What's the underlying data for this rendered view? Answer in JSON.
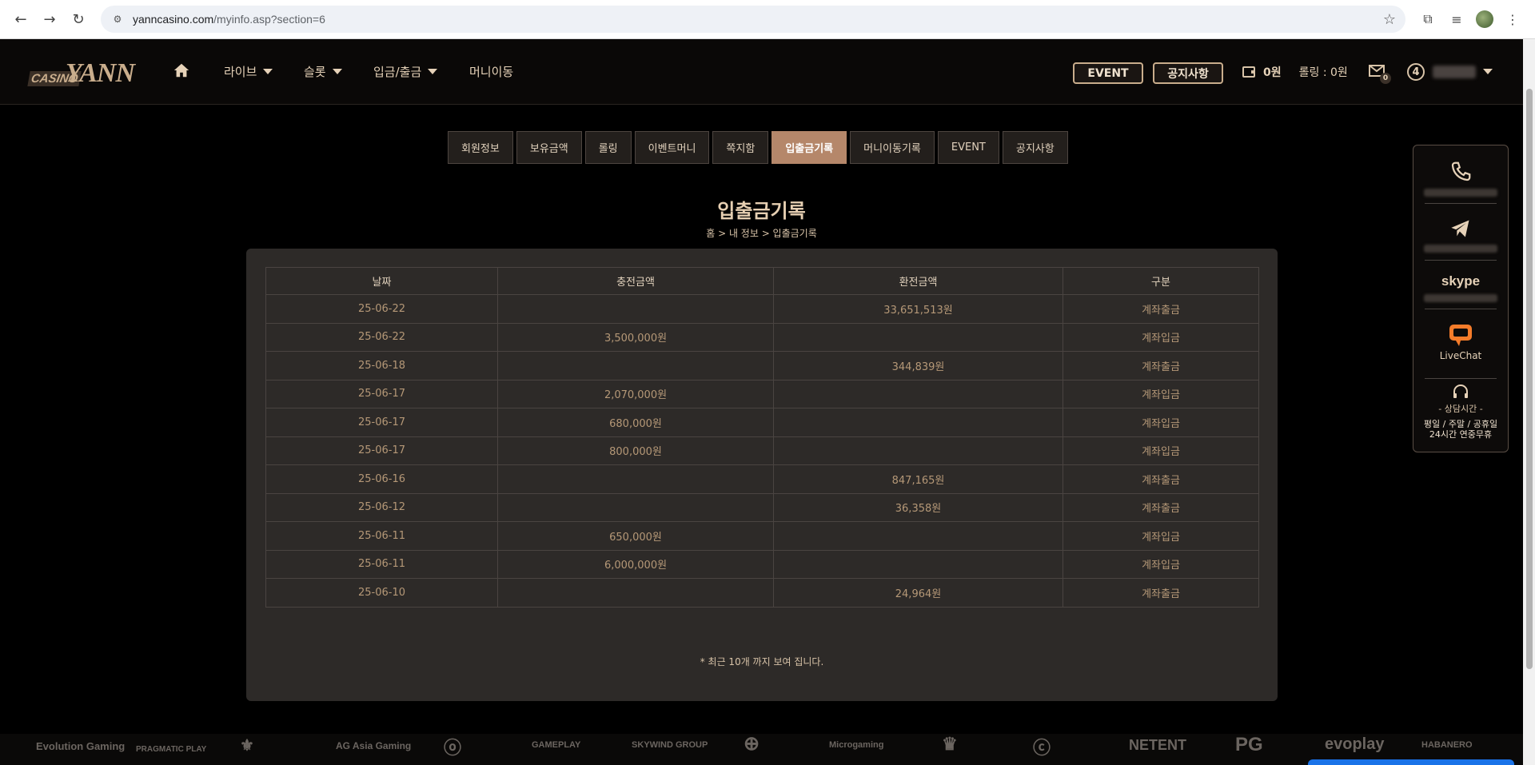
{
  "browser": {
    "url_domain": "yanncasino.com",
    "url_path": "/myinfo.asp?section=6"
  },
  "header": {
    "logo_casino": "CASINO",
    "logo_yann": "YANN",
    "menu": [
      {
        "label": "라이브"
      },
      {
        "label": "슬롯"
      },
      {
        "label": "입금/출금"
      },
      {
        "label": "머니이동"
      }
    ],
    "event_button": "EVENT",
    "notice_button": "공지사항",
    "balance": "0원",
    "rolling": "롤링 : 0원",
    "mail_count": "0",
    "level": "4"
  },
  "tabs": [
    {
      "label": "회원정보",
      "active": false
    },
    {
      "label": "보유금액",
      "active": false
    },
    {
      "label": "롤링",
      "active": false
    },
    {
      "label": "이벤트머니",
      "active": false
    },
    {
      "label": "쪽지함",
      "active": false
    },
    {
      "label": "입출금기록",
      "active": true
    },
    {
      "label": "머니이동기록",
      "active": false
    },
    {
      "label": "EVENT",
      "active": false
    },
    {
      "label": "공지사항",
      "active": false
    }
  ],
  "page": {
    "title": "입출금기록",
    "breadcrumb": "홈 > 내 정보 > 입출금기록",
    "notice": "* 최근 10개 까지 보여 집니다."
  },
  "table": {
    "headers": [
      "날짜",
      "충전금액",
      "환전금액",
      "구분"
    ],
    "rows": [
      [
        "25-06-22",
        "",
        "33,651,513원",
        "계좌출금"
      ],
      [
        "25-06-22",
        "3,500,000원",
        "",
        "계좌입금"
      ],
      [
        "25-06-18",
        "",
        "344,839원",
        "계좌출금"
      ],
      [
        "25-06-17",
        "2,070,000원",
        "",
        "계좌입금"
      ],
      [
        "25-06-17",
        "680,000원",
        "",
        "계좌입금"
      ],
      [
        "25-06-17",
        "800,000원",
        "",
        "계좌입금"
      ],
      [
        "25-06-16",
        "",
        "847,165원",
        "계좌출금"
      ],
      [
        "25-06-12",
        "",
        "36,358원",
        "계좌출금"
      ],
      [
        "25-06-11",
        "650,000원",
        "",
        "계좌입금"
      ],
      [
        "25-06-11",
        "6,000,000원",
        "",
        "계좌입금"
      ],
      [
        "25-06-10",
        "",
        "24,964원",
        "계좌출금"
      ]
    ]
  },
  "side_panel": {
    "skype": "skype",
    "livechat": "LiveChat",
    "hours_title": "- 상담시간 -",
    "hours_line1": "평일 / 주말 / 공휴일",
    "hours_line2": "24시간 연중무휴"
  },
  "providers": [
    "Evolution Gaming",
    "PRAGMATIC PLAY",
    "AG Asia Gaming",
    "GAMEPLAY",
    "SKYWIND GROUP",
    "Microgaming",
    "NETENT",
    "PG",
    "evoplay",
    "HABANERO"
  ],
  "colors": {
    "accent": "#b5876a",
    "text_gold": "#d8c3a8",
    "panel_bg": "#2d2a28"
  }
}
